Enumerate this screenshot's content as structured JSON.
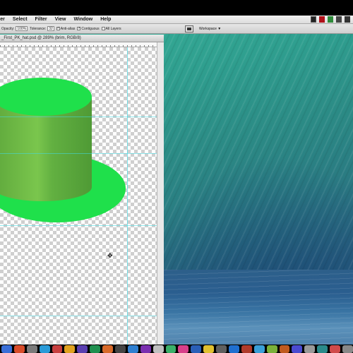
{
  "menubar": {
    "items": [
      "per",
      "Select",
      "Filter",
      "View",
      "Window",
      "Help"
    ]
  },
  "options": {
    "opacity_label": "Opacity:",
    "opacity_value": "100%",
    "tolerance_label": "Tolerance:",
    "tolerance_value": "32",
    "antialias_label": "Anti-alias",
    "contiguous_label": "Contiguous",
    "all_layers_label": "All Layers",
    "workspace_label": "Workspace ▼"
  },
  "document": {
    "title": "_First_PK_hat.psd @ 289% (brim, RGB/8)"
  },
  "colors": {
    "hat_green": "#1fe04b",
    "hat_band": "#5fbf40",
    "guide": "#40dce6",
    "wallpaper_top": "#39b39a",
    "wallpaper_bottom": "#1f4b74"
  },
  "dock": {
    "icons": [
      "finder-icon",
      "app-icon",
      "app-icon",
      "app-icon",
      "app-icon",
      "app-icon",
      "app-icon",
      "app-icon",
      "app-icon",
      "app-icon",
      "app-icon",
      "app-icon",
      "app-icon",
      "app-icon",
      "app-icon",
      "app-icon",
      "app-icon",
      "app-icon",
      "app-icon",
      "app-icon",
      "app-icon",
      "app-icon",
      "app-icon",
      "app-icon",
      "app-icon",
      "app-icon",
      "app-icon",
      "trash-icon"
    ]
  }
}
